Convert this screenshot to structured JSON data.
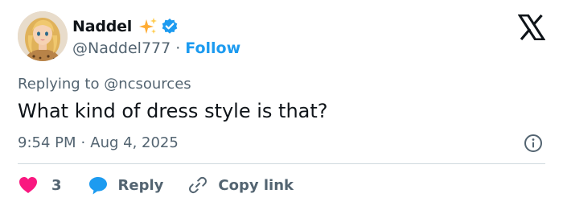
{
  "author": {
    "display_name": "Naddel",
    "handle": "@Naddel777",
    "separator": "·",
    "follow_label": "Follow",
    "avatar_icon": "cartoon-avatar-blonde-woman",
    "name_badge_icon": "sparkles",
    "verified_icon": "verified-badge"
  },
  "tweet": {
    "replying_to": "Replying to @ncsources",
    "text": "What kind of dress style is that?",
    "time": "9:54 PM",
    "separator": "·",
    "date": "Aug 4, 2025"
  },
  "actions": {
    "likes_count": "3",
    "reply_label": "Reply",
    "copy_link_label": "Copy link"
  },
  "icons": {
    "platform_logo": "x-logo",
    "info": "info-icon",
    "like": "heart-icon",
    "reply": "speech-bubble-icon",
    "copy_link": "link-icon"
  },
  "colors": {
    "text_primary": "#0f1419",
    "text_secondary": "#536471",
    "accent_blue": "#1d9bf0",
    "like_pink": "#f91880",
    "divider": "#cfd9de",
    "sparkle_yellow": "#ffac33"
  }
}
